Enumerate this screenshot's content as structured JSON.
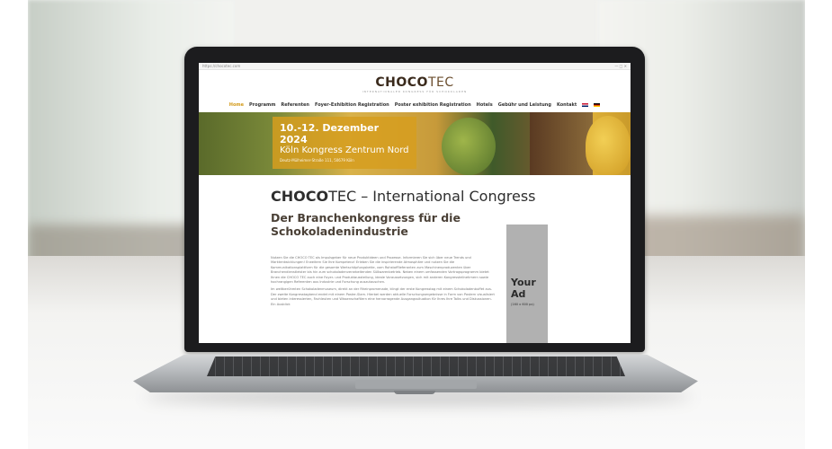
{
  "browser": {
    "url": "https://chocotec.com",
    "controls": "— □ ✕"
  },
  "site": {
    "logo_main": "CHOCO",
    "logo_tec": "TEC",
    "logo_subtitle": "INTERNATIONALER KONGRESS FÜR SCHOKOLADEN"
  },
  "nav": {
    "items": [
      "Home",
      "Programm",
      "Referenten",
      "Foyer-Exhibition Registration",
      "Poster exhibition Registration",
      "Hotels",
      "Gebühr und Leistung",
      "Kontakt"
    ]
  },
  "hero": {
    "date": "10.-12. Dezember 2024",
    "place": "Köln Kongress Zentrum Nord",
    "address": "Deutz-Mülheimer-Straße 111, 50679 Köln"
  },
  "main": {
    "title_bold": "CHOCO",
    "title_rest": "TEC – International Congress",
    "subtitle": "Der Branchenkongress für die Schokoladenindustrie",
    "para1": "Nutzen Sie die CHOCO TEC als Impulsgeber für neue Produktideen und Prozesse. Informieren Sie sich über neue Trends und Marktentwicklungen! Erweitern Sie Ihre Kompetenz! Erleben Sie die inspirierende Atmosphäre und nutzen Sie die Kommunikationsplattform für die gesamte Wertschöpfungskette, vom Rohstofflieferanten zum Maschinenproduzenten über Branchendienstleister bis hin zum schokoladenverarbeitenden Süßwarenbetrieb. Neben einem umfassenden Vortragsprogramm bietet Ihnen die CHOCO TEC auch eine Foyer- und Produktausstellung, ideale Voraussetzungen, sich mit anderen Kongressteilnehmern sowie hochrangigen Referenten aus Industrie und Forschung auszutauschen.",
    "para2": "Im weltberühmten Schokoladenmuseum, direkt an der Rheinpromenade, klingt der erste Kongresstag mit einem Schokoladenbuffet aus. Der zweite Kongresstagbend endet mit einem Poster-Slam. Hierbei werden aktuelle Forschungsergebnisse in Form von Postern visualisiert und bieten interessierten, Fachleuten und Wissenschaftlern eine hervorragende Ausgangssituation für Ihres Ihre Talks und Diskussionen. Ein Ausblick"
  },
  "ad": {
    "title": "Your Ad",
    "size": "(160 x 600 px)"
  },
  "colors": {
    "accent": "#d39a1a",
    "hero_box": "#d69e1e",
    "ad_bg": "#b1b1b1"
  }
}
